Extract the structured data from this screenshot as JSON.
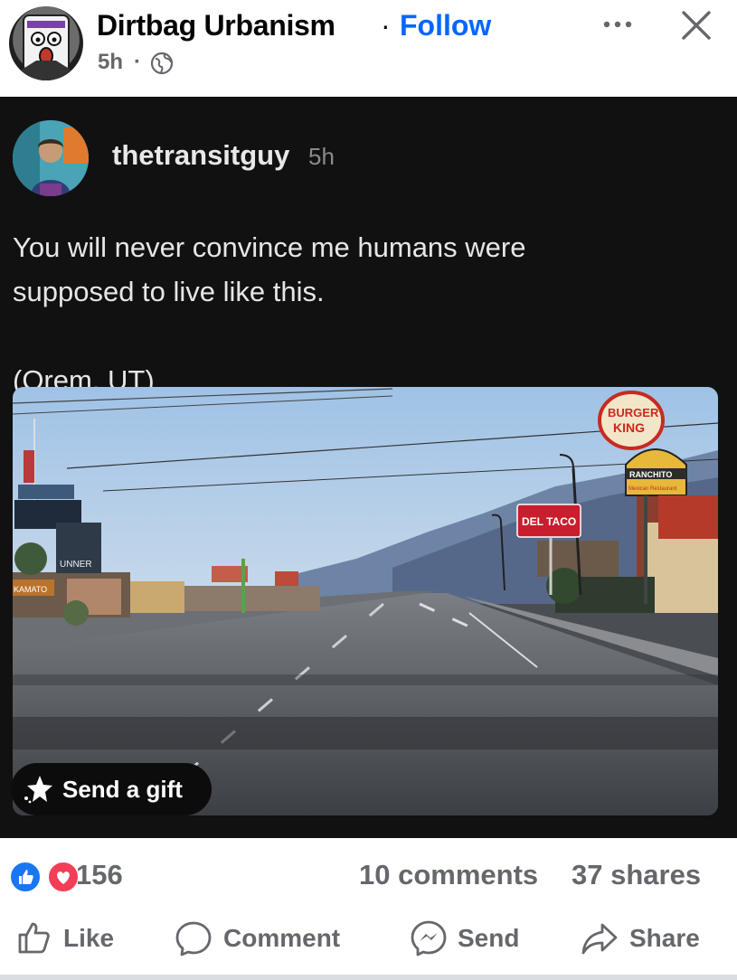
{
  "header": {
    "page_name": "Dirtbag Urbanism",
    "separator": "·",
    "follow_label": "Follow",
    "time": "5h",
    "time_separator": "·",
    "privacy_icon": "globe-icon",
    "more_icon": "more-options-icon",
    "close_icon": "close-icon"
  },
  "embedded_post": {
    "username": "thetransitguy",
    "time": "5h",
    "text": "You will never convince me humans were\nsupposed to live like this.\n\n(Orem, UT)",
    "photo_signs": {
      "burger_king_top": "BURGER",
      "burger_king_bottom": "KING",
      "ranchito_top": "RANCHITO",
      "ranchito_bottom": "Mexican Restaurant",
      "del_taco": "DEL TACO",
      "sign_small": "UNNER",
      "sign_kamato": "KAMATO"
    },
    "gift_label": "Send a gift",
    "gift_icon": "gift-sparkle-icon"
  },
  "stats": {
    "reaction_icons": [
      "like-reaction-icon",
      "love-reaction-icon"
    ],
    "reaction_count": "156",
    "comments": "10 comments",
    "shares": "37 shares"
  },
  "actions": [
    {
      "label": "Like",
      "icon": "thumbs-up-icon"
    },
    {
      "label": "Comment",
      "icon": "comment-bubble-icon"
    },
    {
      "label": "Send",
      "icon": "messenger-icon"
    },
    {
      "label": "Share",
      "icon": "share-arrow-icon"
    }
  ],
  "colors": {
    "accent": "#0866ff",
    "card_bg": "#111112",
    "secondary_text": "#65676b",
    "like_blue": "#1877f2",
    "love_red": "#f33e58"
  }
}
